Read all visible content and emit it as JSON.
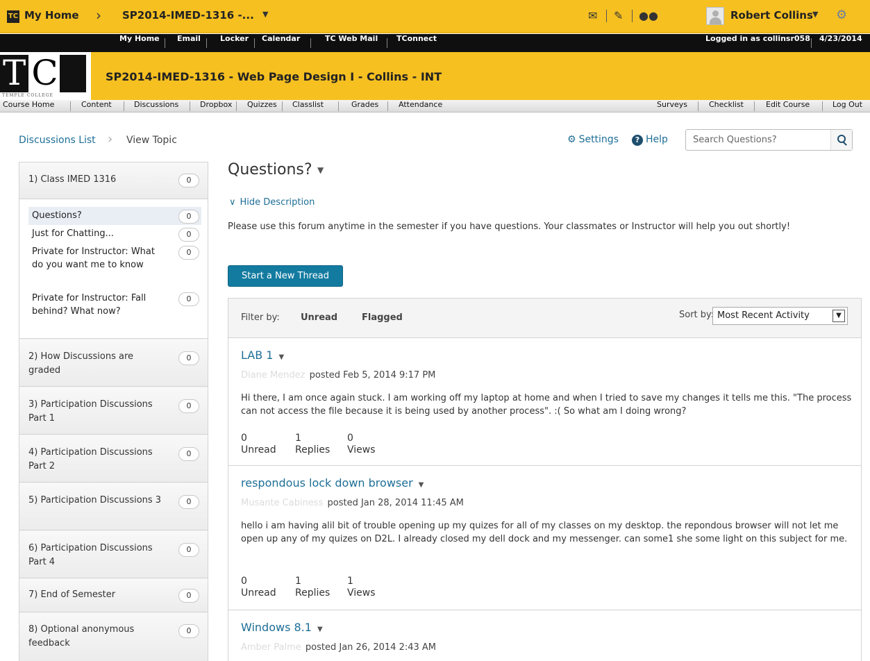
{
  "minibar": {
    "logo": "TC",
    "home": "My Home",
    "course_selector": "SP2014-IMED-1316 -...",
    "user": "Robert Collins"
  },
  "linkbar": {
    "links": [
      "My Home",
      "Email",
      "Locker",
      "Calendar",
      "TC Web Mail",
      "TConnect"
    ],
    "logged_in": "Logged in as collinsr058",
    "date": "4/23/2014"
  },
  "header": {
    "logo_letters": "TC",
    "logo_sub": "TEMPLE COLLEGE",
    "course_title": "SP2014-IMED-1316 - Web Page Design I - Collins - INT"
  },
  "navbar": {
    "left": [
      "Course Home",
      "Content",
      "Discussions",
      "Dropbox",
      "Quizzes",
      "Classlist",
      "Grades",
      "Attendance"
    ],
    "right": [
      "Surveys",
      "Checklist",
      "Edit Course",
      "Log Out"
    ]
  },
  "breadcrumb": {
    "list": "Discussions List",
    "current": "View Topic"
  },
  "tools": {
    "settings": "Settings",
    "help": "Help",
    "search_placeholder": "Search Questions?"
  },
  "sidebar": {
    "categories": [
      {
        "label": "1) Class IMED 1316",
        "count": "0"
      },
      {
        "label": "2) How Discussions are graded",
        "count": "0"
      },
      {
        "label": "3) Participation Discussions Part 1",
        "count": "0"
      },
      {
        "label": "4) Participation Discussions Part 2",
        "count": "0"
      },
      {
        "label": "5) Participation Discussions 3",
        "count": "0"
      },
      {
        "label": "6) Participation Discussions Part 4",
        "count": "0"
      },
      {
        "label": "7) End of Semester",
        "count": "0"
      },
      {
        "label": "8) Optional anonymous feedback",
        "count": "0"
      }
    ],
    "topics": [
      {
        "label": "Questions?",
        "count": "0"
      },
      {
        "label": "Just for Chatting...",
        "count": "0"
      },
      {
        "label": "Private for Instructor: What do you want me to know",
        "count": "0"
      },
      {
        "label": "Private for Instructor: Fall behind? What now?",
        "count": "0"
      }
    ]
  },
  "topic": {
    "title": "Questions?",
    "hide_description": "Hide Description",
    "description": "Please use this forum anytime in the semester if you have questions. Your classmates or Instructor will help you out shortly!",
    "new_thread": "Start a New Thread"
  },
  "filters": {
    "label": "Filter by:",
    "unread": "Unread",
    "flagged": "Flagged",
    "sort_label": "Sort by:",
    "sort_value": "Most Recent Activity"
  },
  "threads": [
    {
      "title": "LAB 1",
      "author": "Diane Mendez",
      "posted": "posted Feb 5, 2014 9:17 PM",
      "body": "Hi there, I am once again stuck. I am working off my laptop at home and when I tried to save my changes it tells me this. \"The process can not access the file because it is being used by another process\". :( So what am I doing wrong?",
      "unread": "0",
      "replies": "1",
      "views": "0"
    },
    {
      "title": "respondous lock down browser",
      "author": "Musante Cabiness",
      "posted": "posted Jan 28, 2014 11:45 AM",
      "body": "hello i am having alil bit of trouble opening up my quizes for all of my classes on my desktop. the repondous browser will not let me open up any of my quizes on D2L. I already closed my dell dock and my messenger. can some1 she some light on this subject for me.",
      "unread": "0",
      "replies": "1",
      "views": "1"
    },
    {
      "title": "Windows 8.1",
      "author": "Amber Palme",
      "posted": "posted Jan 26, 2014 2:43 AM"
    }
  ],
  "stat_labels": {
    "unread": "Unread",
    "replies": "Replies",
    "views": "Views"
  }
}
